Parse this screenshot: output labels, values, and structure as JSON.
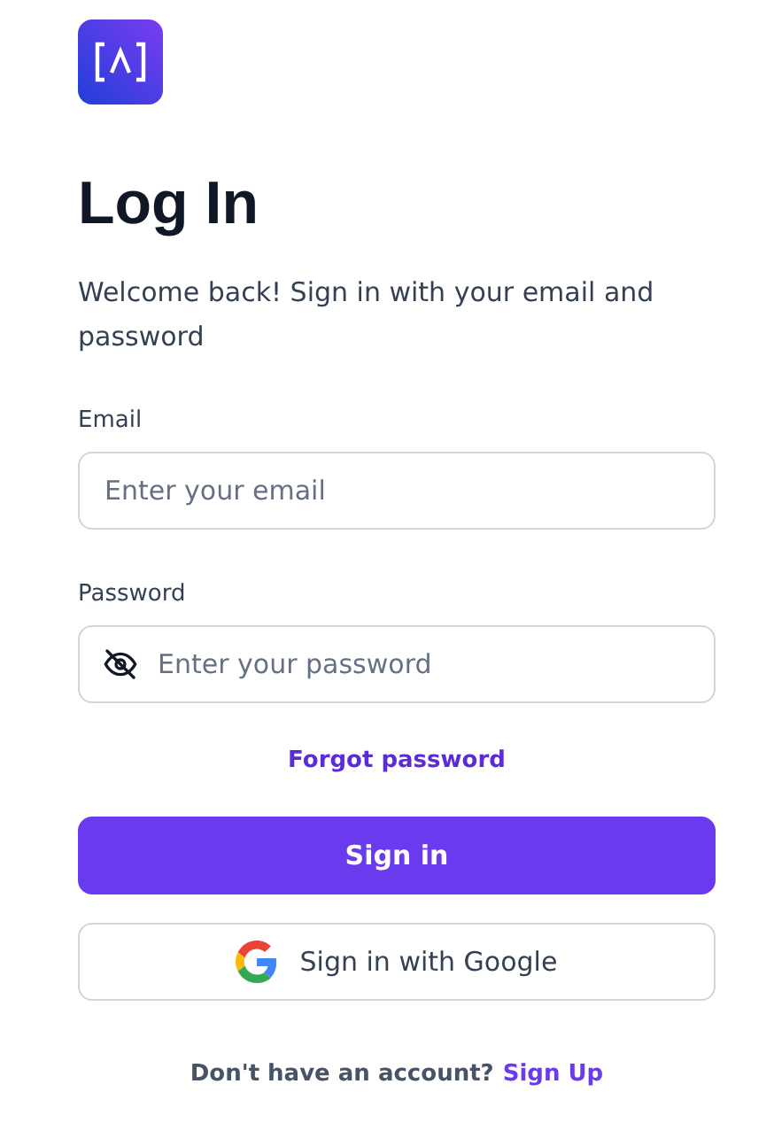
{
  "title": "Log In",
  "subtitle": "Welcome back! Sign in with your email and password",
  "fields": [
    {
      "label": "Email",
      "placeholder": "Enter your email",
      "kind": "text"
    },
    {
      "label": "Password",
      "placeholder": "Enter your password",
      "kind": "password"
    }
  ],
  "forgot_link": "Forgot password",
  "primary_button": "Sign in",
  "google_button": "Sign in with Google",
  "footer": {
    "text": "Don't have an account?",
    "link": "Sign Up"
  }
}
